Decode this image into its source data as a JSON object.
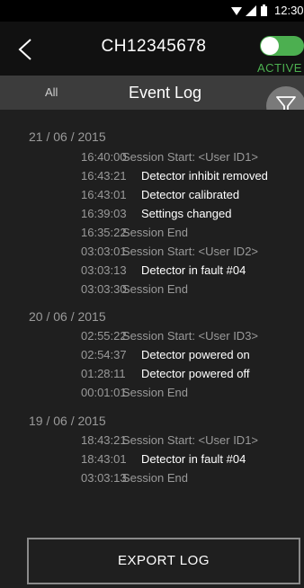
{
  "status_bar": {
    "time": "12:30",
    "icons": [
      "wifi-icon",
      "signal-icon",
      "battery-icon"
    ]
  },
  "header": {
    "title": "CH12345678",
    "back_icon": "chevron-left-icon",
    "toggle_on": true,
    "active_label": "ACTIVE",
    "accent_color": "#4caf50"
  },
  "tabs": {
    "all_label": "All",
    "event_log_label": "Event Log",
    "filter_icon": "filter-icon"
  },
  "log": {
    "groups": [
      {
        "date": "21 / 06 / 2015",
        "entries": [
          {
            "time": "16:40:00",
            "text": "Session Start: <User ID1>",
            "style": "grey"
          },
          {
            "time": "16:43:21",
            "text": "Detector inhibit removed",
            "style": "white"
          },
          {
            "time": "16:43:01",
            "text": "Detector calibrated",
            "style": "white"
          },
          {
            "time": "16:39:03",
            "text": "Settings changed",
            "style": "white"
          },
          {
            "time": "16:35:22",
            "text": "Session End",
            "style": "grey"
          },
          {
            "time": "03:03:01",
            "text": "Session Start: <User ID2>",
            "style": "grey"
          },
          {
            "time": "03:03:13",
            "text": "Detector in fault #04",
            "style": "white"
          },
          {
            "time": "03:03:30",
            "text": "Session End",
            "style": "grey"
          }
        ]
      },
      {
        "date": "20 / 06 / 2015",
        "entries": [
          {
            "time": "02:55:22",
            "text": "Session Start: <User ID3>",
            "style": "grey"
          },
          {
            "time": "02:54:37",
            "text": "Detector powered on",
            "style": "white"
          },
          {
            "time": "01:28:11",
            "text": "Detector powered off",
            "style": "white"
          },
          {
            "time": "00:01:01",
            "text": "Session End",
            "style": "grey"
          }
        ]
      },
      {
        "date": "19 / 06 / 2015",
        "entries": [
          {
            "time": "18:43:21",
            "text": "Session Start: <User ID1>",
            "style": "grey"
          },
          {
            "time": "18:43:01",
            "text": "Detector in fault #04",
            "style": "white"
          },
          {
            "time": "03:03:13",
            "text": "Session End",
            "style": "grey"
          }
        ]
      }
    ]
  },
  "footer": {
    "export_label": "EXPORT LOG"
  }
}
